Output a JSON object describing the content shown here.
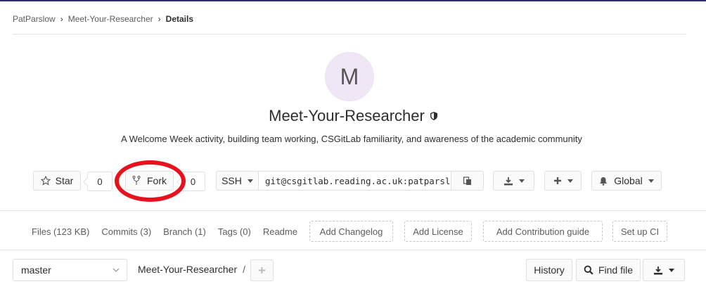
{
  "breadcrumb": {
    "items": [
      "PatParslow",
      "Meet-Your-Researcher"
    ],
    "current": "Details"
  },
  "project": {
    "avatar_letter": "M",
    "name": "Meet-Your-Researcher",
    "visibility_icon": "shield-icon",
    "description": "A Welcome Week activity, building team working, CSGitLab familiarity, and awareness of the academic community"
  },
  "actions": {
    "star_label": "Star",
    "star_count": "0",
    "fork_label": "Fork",
    "fork_count": "0",
    "clone_protocol": "SSH",
    "clone_url": "git@csgitlab.reading.ac.uk:patparslow/meet-your-researcher.git",
    "notification_label": "Global"
  },
  "stats": {
    "files": "Files (123 KB)",
    "commits": "Commits (3)",
    "branch": "Branch (1)",
    "tags": "Tags (0)",
    "readme": "Readme",
    "add_changelog": "Add Changelog",
    "add_license": "Add License",
    "add_contribution": "Add Contribution guide",
    "setup_ci": "Set up CI"
  },
  "repo": {
    "branch": "master",
    "path": "Meet-Your-Researcher",
    "path_sep": "/",
    "history_label": "History",
    "find_file_label": "Find file"
  },
  "colors": {
    "annotation": "#e8121f",
    "avatar_bg": "#f0e7f6",
    "topbar": "#2f2a6b"
  }
}
